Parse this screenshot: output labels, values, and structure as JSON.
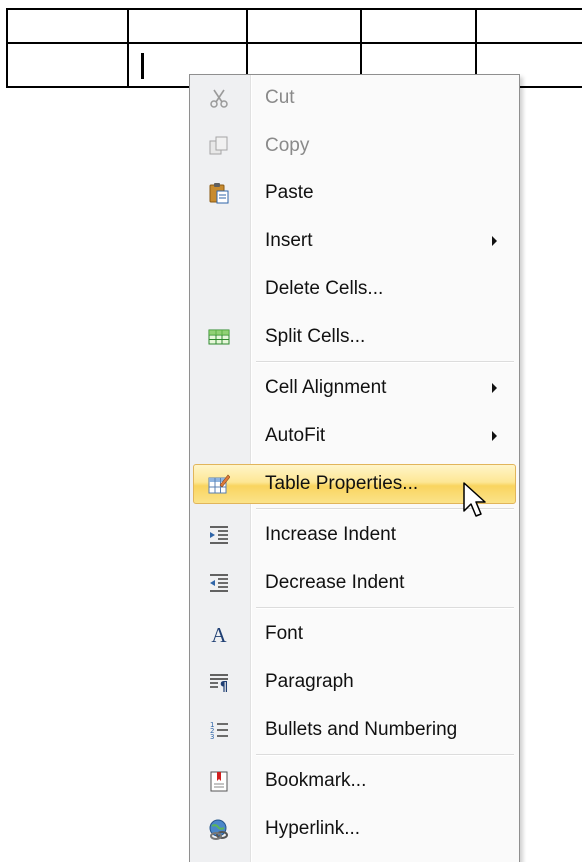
{
  "context_menu": {
    "items": [
      {
        "label": "Cut",
        "icon": "scissors-icon",
        "disabled": true,
        "submenu": false
      },
      {
        "label": "Copy",
        "icon": "copy-icon",
        "disabled": true,
        "submenu": false
      },
      {
        "label": "Paste",
        "icon": "paste-icon",
        "disabled": false,
        "submenu": false
      },
      {
        "label": "Insert",
        "icon": "",
        "disabled": false,
        "submenu": true
      },
      {
        "label": "Delete Cells...",
        "icon": "",
        "disabled": false,
        "submenu": false
      },
      {
        "label": "Split Cells...",
        "icon": "split-cells-icon",
        "disabled": false,
        "submenu": false
      },
      {
        "label": "Cell Alignment",
        "icon": "",
        "disabled": false,
        "submenu": true
      },
      {
        "label": "AutoFit",
        "icon": "",
        "disabled": false,
        "submenu": true
      },
      {
        "label": "Table Properties...",
        "icon": "table-properties-icon",
        "disabled": false,
        "submenu": false,
        "highlighted": true
      },
      {
        "label": "Increase Indent",
        "icon": "increase-indent-icon",
        "disabled": false,
        "submenu": false
      },
      {
        "label": "Decrease Indent",
        "icon": "decrease-indent-icon",
        "disabled": false,
        "submenu": false
      },
      {
        "label": "Font",
        "icon": "font-icon",
        "disabled": false,
        "submenu": false
      },
      {
        "label": "Paragraph",
        "icon": "paragraph-icon",
        "disabled": false,
        "submenu": false
      },
      {
        "label": "Bullets and Numbering",
        "icon": "bullets-numbering-icon",
        "disabled": false,
        "submenu": false
      },
      {
        "label": "Bookmark...",
        "icon": "bookmark-icon",
        "disabled": false,
        "submenu": false
      },
      {
        "label": "Hyperlink...",
        "icon": "hyperlink-icon",
        "disabled": false,
        "submenu": false
      }
    ]
  },
  "colors": {
    "highlight_fill": "#fde795",
    "highlight_border": "#e1b55b",
    "disabled_text": "#8a8a8a"
  }
}
